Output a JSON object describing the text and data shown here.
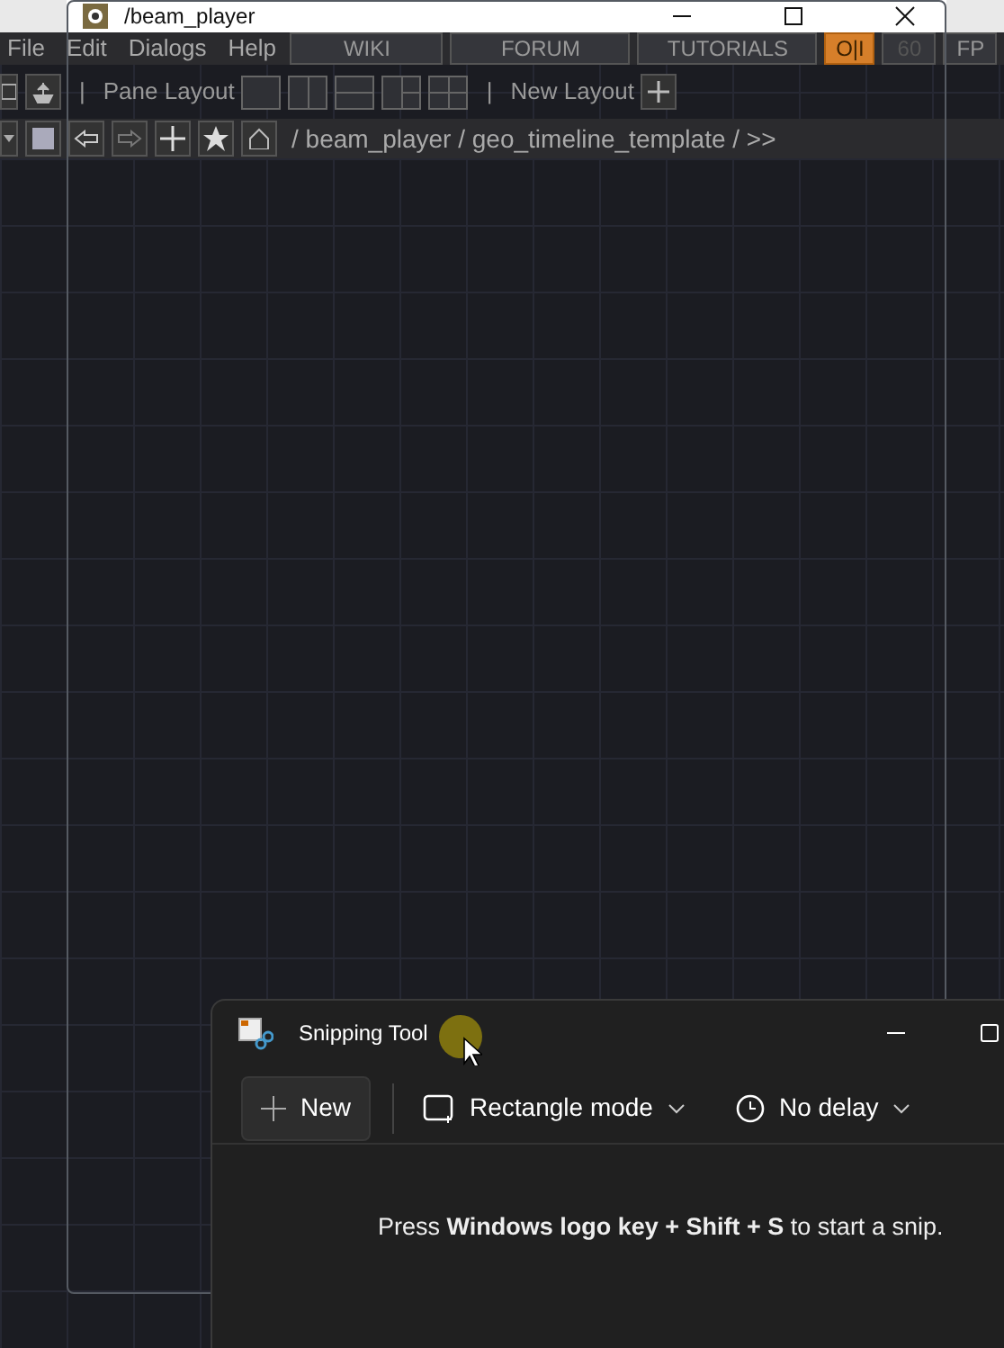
{
  "window": {
    "title": "/beam_player"
  },
  "menu": [
    "File",
    "Edit",
    "Dialogs",
    "Help"
  ],
  "header_buttons": [
    {
      "label": "WIKI"
    },
    {
      "label": "FORUM"
    },
    {
      "label": "TUTORIALS"
    }
  ],
  "perform_toggle": {
    "label": "O|I",
    "on": true
  },
  "fps": "60",
  "fp_label": "FP",
  "toolbar": {
    "separator": "|",
    "pane_layout_label": "Pane Layout",
    "layouts": [
      {
        "kind": "single"
      },
      {
        "kind": "columns"
      },
      {
        "kind": "rows"
      },
      {
        "kind": "split"
      },
      {
        "kind": "quad"
      }
    ],
    "new_layout_label": "New Layout"
  },
  "path": "/ beam_player / geo_timeline_template / >>",
  "snipping_tool": {
    "title": "Snipping Tool",
    "new_button": "New",
    "mode": "Rectangle mode",
    "delay": "No delay",
    "hint": "Press **Windows logo key + Shift + S** to start a snip."
  }
}
